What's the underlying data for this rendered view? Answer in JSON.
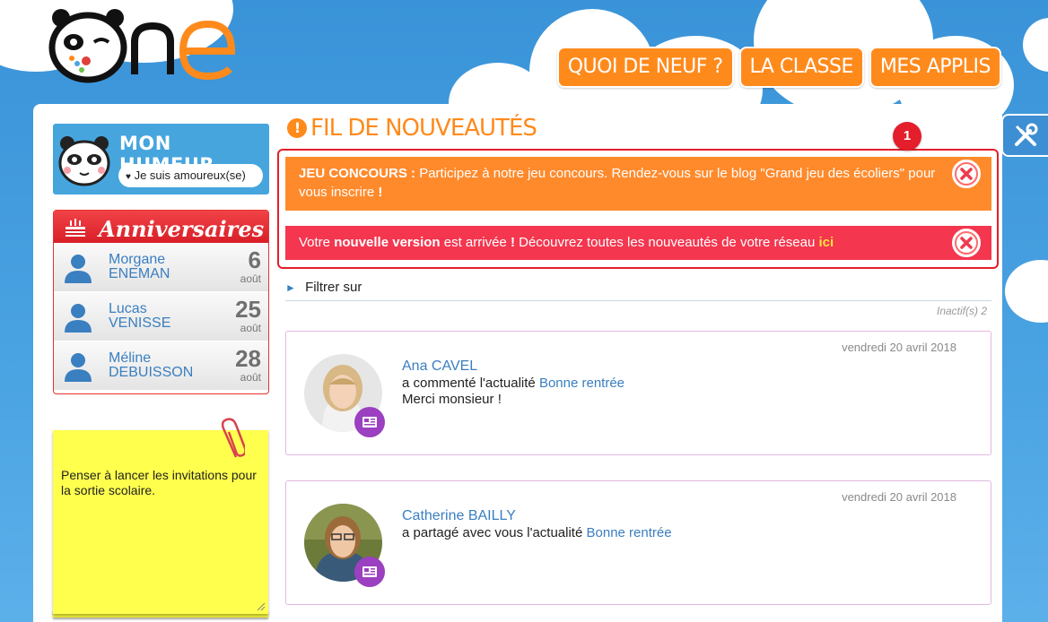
{
  "nav": {
    "items": [
      "QUOI DE NEUF ?",
      "LA CLASSE",
      "MES APPLIS"
    ]
  },
  "mood": {
    "title": "MON HUMEUR",
    "value": "Je suis amoureux(se)"
  },
  "birthdays": {
    "title": "Anniversaires",
    "rows": [
      {
        "first": "Morgane",
        "last": "ENEMAN",
        "day": "6",
        "month": "août"
      },
      {
        "first": "Lucas",
        "last": "VENISSE",
        "day": "25",
        "month": "août"
      },
      {
        "first": "Méline",
        "last": "DEBUISSON",
        "day": "28",
        "month": "août"
      }
    ]
  },
  "postit": {
    "text": "Penser à lancer les invitations pour la sortie scolaire."
  },
  "feed": {
    "title": "FIL DE NOUVEAUTÉS",
    "badge": "1",
    "notifications": {
      "contest": {
        "bold": "JEU CONCOURS :",
        "text": "Participez à notre jeu concours. Rendez-vous sur le blog \"Grand jeu des écoliers\" pour vous inscrire",
        "end": "!"
      },
      "version": {
        "pre": "Votre",
        "bold": "nouvelle version",
        "mid": "est arrivée",
        "bang": "!",
        "text": "Découvrez toutes les nouveautés de votre réseau",
        "link": "ici"
      }
    },
    "filter_label": "Filtrer sur",
    "inactive_label": "Inactif(s) 2",
    "posts": [
      {
        "date": "vendredi 20 avril 2018",
        "author": "Ana CAVEL",
        "action": "a commenté l'actualité",
        "link": "Bonne rentrée",
        "comment": "Merci monsieur !"
      },
      {
        "date": "vendredi 20 avril 2018",
        "author": "Catherine BAILLY",
        "action": "a partagé avec vous l'actualité",
        "link": "Bonne rentrée",
        "comment": ""
      }
    ]
  },
  "icons": {
    "tools": "wrench-screwdriver-icon",
    "close": "close-circle-icon",
    "person": "person-icon",
    "news": "newspaper-icon",
    "cake": "cake-icon",
    "heart": "heart-icon",
    "paperclip": "paperclip-icon"
  },
  "colors": {
    "orange": "#ff8a1c",
    "red": "#f4364f",
    "blue": "#46a5dd",
    "link": "#3a7fc0",
    "postit": "#ffff4d",
    "purple": "#9b40c0"
  }
}
